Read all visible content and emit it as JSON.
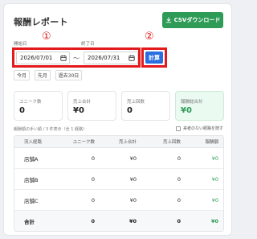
{
  "page": {
    "title": "報酬レポート"
  },
  "toolbar": {
    "csv_label": "CSVダウンロード"
  },
  "annotations": {
    "mark1": "①",
    "mark2": "②"
  },
  "filters": {
    "start_label": "開始日",
    "end_label": "終了日",
    "start_value": "2026/07/01",
    "end_value": "2026/07/31",
    "separator": "〜",
    "calc_label": "計算",
    "presets": [
      "今月",
      "先月",
      "過去30日"
    ]
  },
  "stats": [
    {
      "label": "ユニーク数",
      "value": "0"
    },
    {
      "label": "売上合計",
      "value": "¥0"
    },
    {
      "label": "売上回数",
      "value": "0"
    },
    {
      "label": "報酬総合計",
      "value": "¥0"
    }
  ],
  "table": {
    "caption": "報酬額の手い順 / 3 件表示（全 1 経路）",
    "toggle_label": "来者のない経路を隠す",
    "headers": [
      "流入経路",
      "ユニーク数",
      "売上合計",
      "売上回数",
      "報酬額"
    ],
    "rows": [
      [
        "店舗A",
        "0",
        "¥0",
        "0",
        "¥0"
      ],
      [
        "店舗B",
        "0",
        "¥0",
        "0",
        "¥0"
      ],
      [
        "店舗C",
        "0",
        "¥0",
        "0",
        "¥0"
      ]
    ],
    "total": [
      "合計",
      "0",
      "¥0",
      "0",
      "¥0"
    ]
  },
  "colors": {
    "accent_green": "#2e9b57",
    "accent_blue": "#2a6fe0",
    "highlight_red": "#e3191b"
  }
}
